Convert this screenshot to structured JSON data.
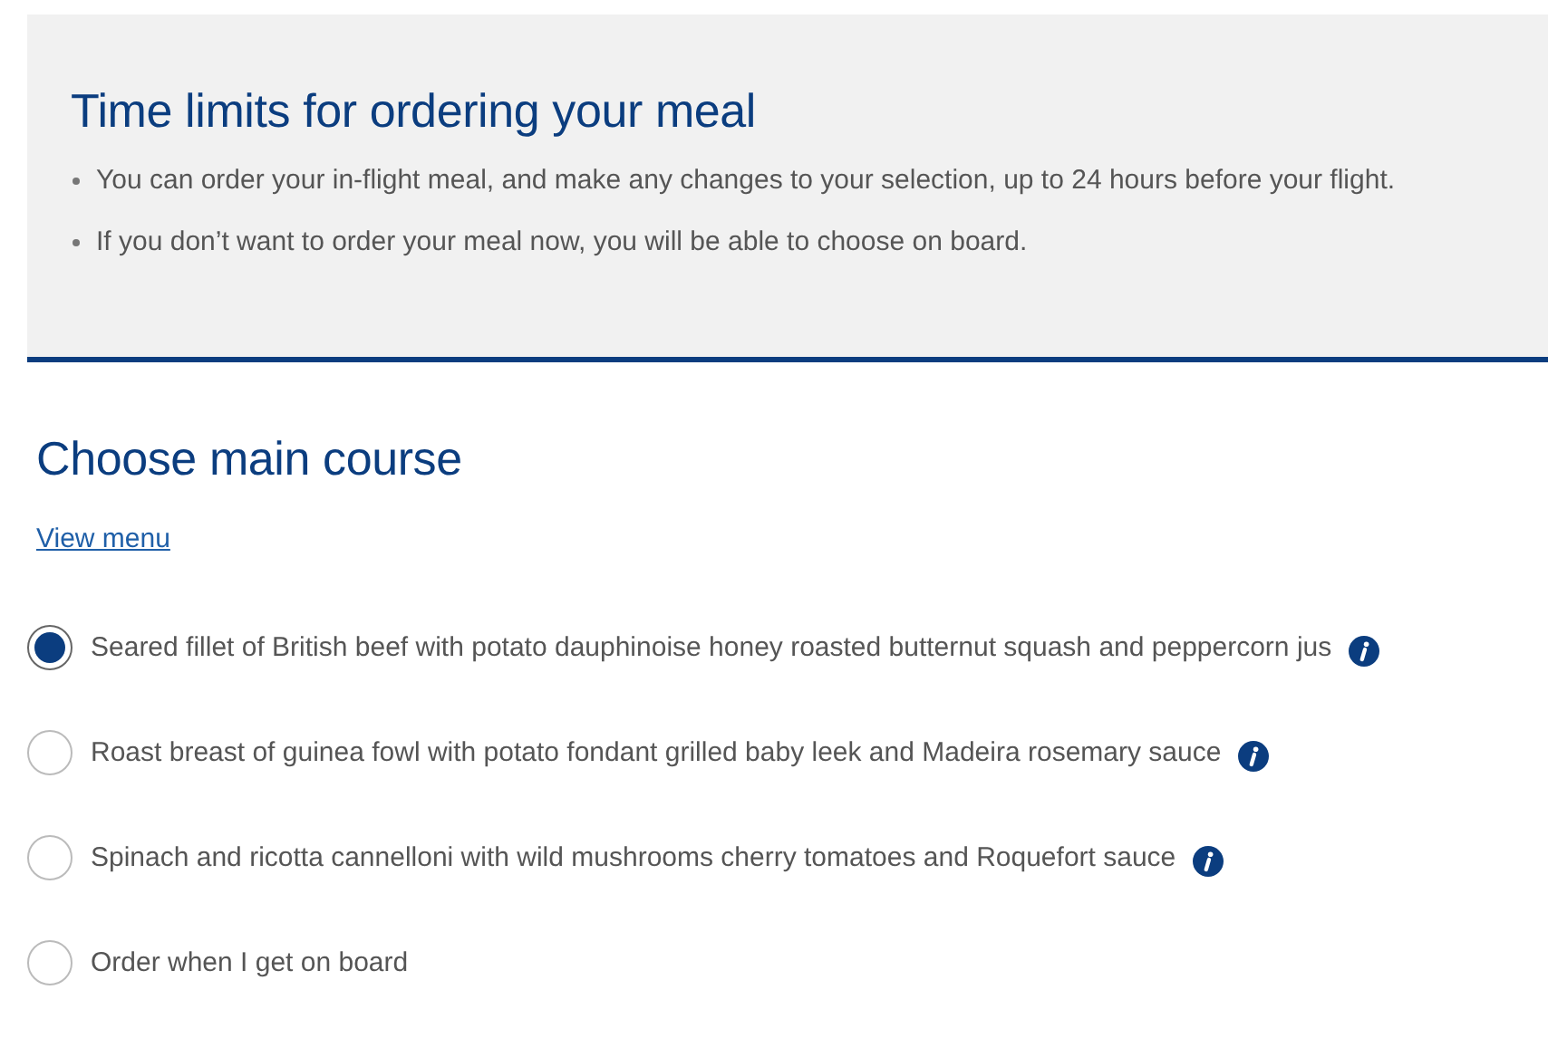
{
  "notice": {
    "title": "Time limits for ordering your meal",
    "points": [
      "You can order your in-flight meal, and make any changes to your selection, up to 24 hours before your flight.",
      "If you don’t want to order your meal now, you will be able to choose on board."
    ]
  },
  "main_course": {
    "title": "Choose main course",
    "link": "View menu",
    "options": [
      {
        "label": "Seared fillet of British beef with potato dauphinoise honey roasted butternut squash and peppercorn jus",
        "selected": true,
        "info": true
      },
      {
        "label": "Roast breast of guinea fowl with potato fondant grilled baby leek and Madeira rosemary sauce",
        "selected": false,
        "info": true
      },
      {
        "label": "Spinach and ricotta cannelloni with wild mushrooms cherry tomatoes and Roquefort sauce",
        "selected": false,
        "info": true
      },
      {
        "label": "Order when I get on board",
        "selected": false,
        "info": false
      }
    ]
  }
}
